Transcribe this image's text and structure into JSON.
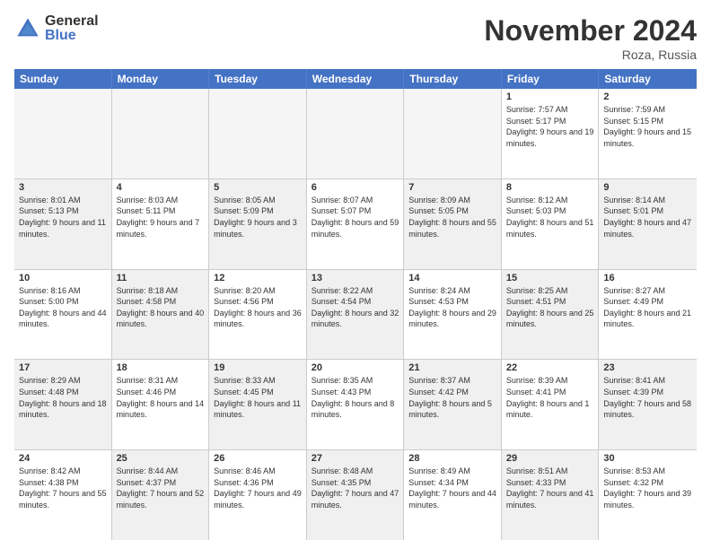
{
  "logo": {
    "general": "General",
    "blue": "Blue"
  },
  "title": "November 2024",
  "location": "Roza, Russia",
  "days": [
    "Sunday",
    "Monday",
    "Tuesday",
    "Wednesday",
    "Thursday",
    "Friday",
    "Saturday"
  ],
  "rows": [
    [
      {
        "day": "",
        "empty": true
      },
      {
        "day": "",
        "empty": true
      },
      {
        "day": "",
        "empty": true
      },
      {
        "day": "",
        "empty": true
      },
      {
        "day": "",
        "empty": true
      },
      {
        "day": "1",
        "text": "Sunrise: 7:57 AM\nSunset: 5:17 PM\nDaylight: 9 hours and 19 minutes."
      },
      {
        "day": "2",
        "text": "Sunrise: 7:59 AM\nSunset: 5:15 PM\nDaylight: 9 hours and 15 minutes."
      }
    ],
    [
      {
        "day": "3",
        "shaded": true,
        "text": "Sunrise: 8:01 AM\nSunset: 5:13 PM\nDaylight: 9 hours and 11 minutes."
      },
      {
        "day": "4",
        "text": "Sunrise: 8:03 AM\nSunset: 5:11 PM\nDaylight: 9 hours and 7 minutes."
      },
      {
        "day": "5",
        "shaded": true,
        "text": "Sunrise: 8:05 AM\nSunset: 5:09 PM\nDaylight: 9 hours and 3 minutes."
      },
      {
        "day": "6",
        "text": "Sunrise: 8:07 AM\nSunset: 5:07 PM\nDaylight: 8 hours and 59 minutes."
      },
      {
        "day": "7",
        "shaded": true,
        "text": "Sunrise: 8:09 AM\nSunset: 5:05 PM\nDaylight: 8 hours and 55 minutes."
      },
      {
        "day": "8",
        "text": "Sunrise: 8:12 AM\nSunset: 5:03 PM\nDaylight: 8 hours and 51 minutes."
      },
      {
        "day": "9",
        "shaded": true,
        "text": "Sunrise: 8:14 AM\nSunset: 5:01 PM\nDaylight: 8 hours and 47 minutes."
      }
    ],
    [
      {
        "day": "10",
        "text": "Sunrise: 8:16 AM\nSunset: 5:00 PM\nDaylight: 8 hours and 44 minutes."
      },
      {
        "day": "11",
        "shaded": true,
        "text": "Sunrise: 8:18 AM\nSunset: 4:58 PM\nDaylight: 8 hours and 40 minutes."
      },
      {
        "day": "12",
        "text": "Sunrise: 8:20 AM\nSunset: 4:56 PM\nDaylight: 8 hours and 36 minutes."
      },
      {
        "day": "13",
        "shaded": true,
        "text": "Sunrise: 8:22 AM\nSunset: 4:54 PM\nDaylight: 8 hours and 32 minutes."
      },
      {
        "day": "14",
        "text": "Sunrise: 8:24 AM\nSunset: 4:53 PM\nDaylight: 8 hours and 29 minutes."
      },
      {
        "day": "15",
        "shaded": true,
        "text": "Sunrise: 8:25 AM\nSunset: 4:51 PM\nDaylight: 8 hours and 25 minutes."
      },
      {
        "day": "16",
        "text": "Sunrise: 8:27 AM\nSunset: 4:49 PM\nDaylight: 8 hours and 21 minutes."
      }
    ],
    [
      {
        "day": "17",
        "shaded": true,
        "text": "Sunrise: 8:29 AM\nSunset: 4:48 PM\nDaylight: 8 hours and 18 minutes."
      },
      {
        "day": "18",
        "text": "Sunrise: 8:31 AM\nSunset: 4:46 PM\nDaylight: 8 hours and 14 minutes."
      },
      {
        "day": "19",
        "shaded": true,
        "text": "Sunrise: 8:33 AM\nSunset: 4:45 PM\nDaylight: 8 hours and 11 minutes."
      },
      {
        "day": "20",
        "text": "Sunrise: 8:35 AM\nSunset: 4:43 PM\nDaylight: 8 hours and 8 minutes."
      },
      {
        "day": "21",
        "shaded": true,
        "text": "Sunrise: 8:37 AM\nSunset: 4:42 PM\nDaylight: 8 hours and 5 minutes."
      },
      {
        "day": "22",
        "text": "Sunrise: 8:39 AM\nSunset: 4:41 PM\nDaylight: 8 hours and 1 minute."
      },
      {
        "day": "23",
        "shaded": true,
        "text": "Sunrise: 8:41 AM\nSunset: 4:39 PM\nDaylight: 7 hours and 58 minutes."
      }
    ],
    [
      {
        "day": "24",
        "text": "Sunrise: 8:42 AM\nSunset: 4:38 PM\nDaylight: 7 hours and 55 minutes."
      },
      {
        "day": "25",
        "shaded": true,
        "text": "Sunrise: 8:44 AM\nSunset: 4:37 PM\nDaylight: 7 hours and 52 minutes."
      },
      {
        "day": "26",
        "text": "Sunrise: 8:46 AM\nSunset: 4:36 PM\nDaylight: 7 hours and 49 minutes."
      },
      {
        "day": "27",
        "shaded": true,
        "text": "Sunrise: 8:48 AM\nSunset: 4:35 PM\nDaylight: 7 hours and 47 minutes."
      },
      {
        "day": "28",
        "text": "Sunrise: 8:49 AM\nSunset: 4:34 PM\nDaylight: 7 hours and 44 minutes."
      },
      {
        "day": "29",
        "shaded": true,
        "text": "Sunrise: 8:51 AM\nSunset: 4:33 PM\nDaylight: 7 hours and 41 minutes."
      },
      {
        "day": "30",
        "text": "Sunrise: 8:53 AM\nSunset: 4:32 PM\nDaylight: 7 hours and 39 minutes."
      }
    ]
  ]
}
